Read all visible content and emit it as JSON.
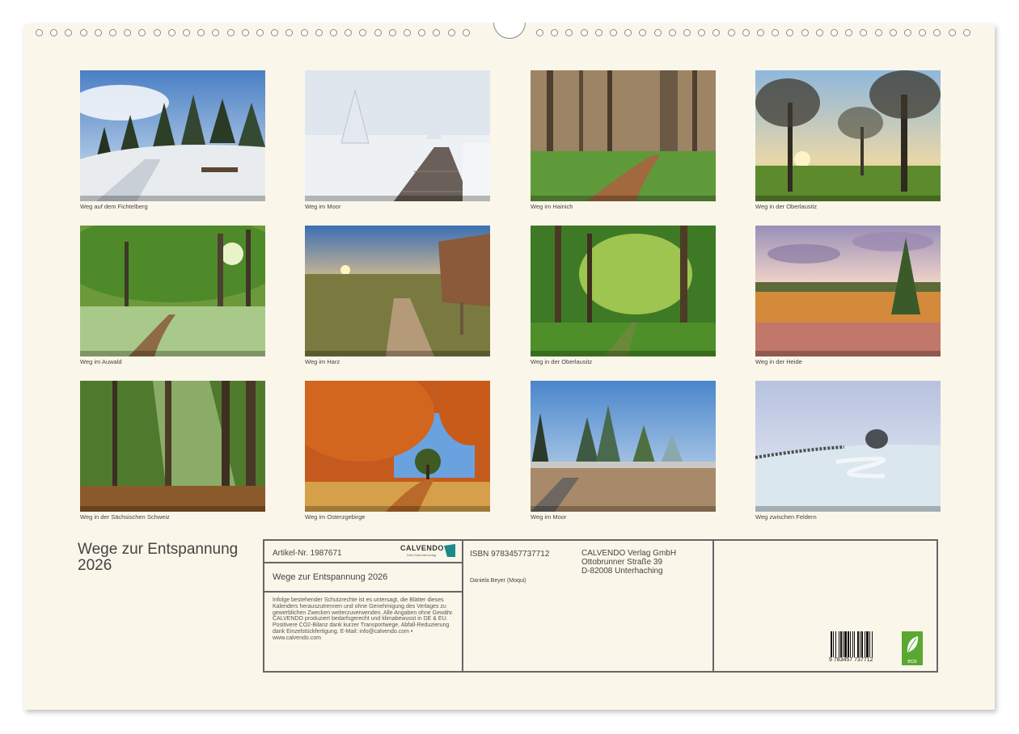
{
  "photos": [
    {
      "caption": "Weg auf dem Fichtelberg"
    },
    {
      "caption": "Weg im Moor"
    },
    {
      "caption": "Weg im Hainich"
    },
    {
      "caption": "Weg in der Oberlausitz"
    },
    {
      "caption": "Weg im Auwald"
    },
    {
      "caption": "Weg im Harz"
    },
    {
      "caption": "Weg in der Oberlausitz"
    },
    {
      "caption": "Weg in der Heide"
    },
    {
      "caption": "Weg in der Sächsischen Schweiz"
    },
    {
      "caption": "Weg im Osterzgebirge"
    },
    {
      "caption": "Weg im Moor"
    },
    {
      "caption": "Weg zwischen Feldern"
    }
  ],
  "title_line1": "Wege zur Entspannung",
  "title_line2": "2026",
  "info": {
    "article": "Artikel-Nr. 1987671",
    "logo_text": "CALVENDO",
    "logo_sub": "Dein Kalenderverlag",
    "calendar_title": "Wege zur Entspannung 2026",
    "legal": "Infolge bestehender Schutzrechte ist es untersagt, die Blätter dieses Kalenders herauszutrennen und ohne Genehmigung des Verlages zu gewerblichen Zwecken weiterzuverwenden. Alle Angaben ohne Gewähr. CALVENDO produziert bedarfsgerecht und klimabewusst in DE & EU. Positivere CO2-Bilanz dank kurzer Transportwege. Abfall-Reduzierung dank Einzelstückfertigung. E-Mail: info@calvendo.com • www.calvendo.com",
    "isbn": "ISBN 9783457737712",
    "author": "Daniela Beyer (Moqui)",
    "publisher_line1": "CALVENDO Verlag GmbH",
    "publisher_line2": "Ottobrunner Straße 39",
    "publisher_line3": "D-82008 Unterhaching",
    "barcode_number": "9 783457 737712",
    "eco_label": "eco"
  },
  "colors": {
    "paper": "#fbf6ea",
    "border": "#666666",
    "logo_teal": "#1a8a8a",
    "eco_green": "#5aa832"
  }
}
